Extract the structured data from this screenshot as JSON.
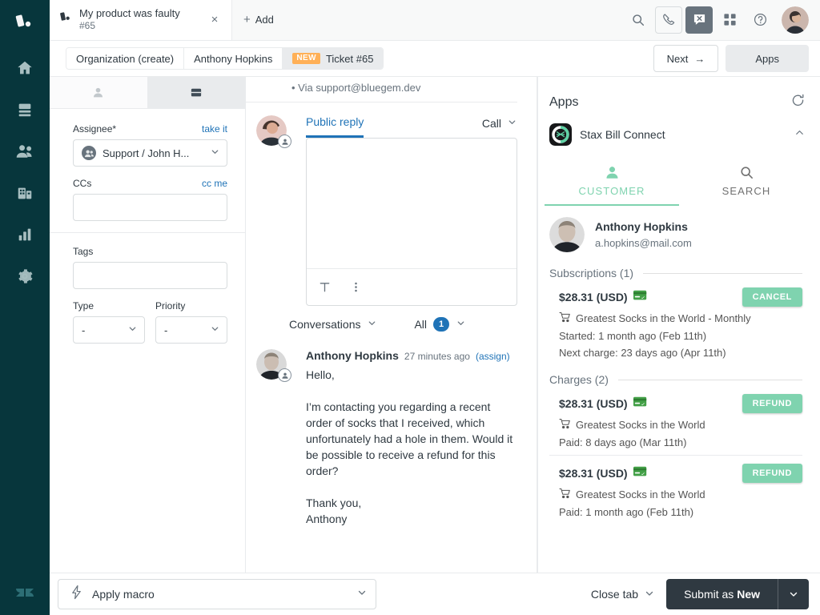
{
  "nav": {
    "logo_icon": "zendesk-product-tray-icon",
    "items": [
      {
        "label": "Home",
        "icon": "home-icon"
      },
      {
        "label": "Views",
        "icon": "views-icon"
      },
      {
        "label": "Customers",
        "icon": "customers-icon"
      },
      {
        "label": "Organizations",
        "icon": "organizations-icon"
      },
      {
        "label": "Reporting",
        "icon": "reporting-icon"
      },
      {
        "label": "Admin",
        "icon": "gear-icon"
      }
    ],
    "bottom_logo_icon": "zendesk-logo-icon"
  },
  "topbar": {
    "ticket_tab": {
      "title": "My product was faulty",
      "subtitle": "#65",
      "icon": "ticket-icon",
      "close": "×"
    },
    "add_tab_label": "Add",
    "add_tab_plus": "+",
    "actions": [
      {
        "name": "search-icon"
      },
      {
        "name": "call-icon"
      },
      {
        "name": "chat-disabled-icon"
      },
      {
        "name": "apps-grid-icon"
      },
      {
        "name": "help-icon"
      }
    ],
    "avatar_name": "user-avatar"
  },
  "breadcrumb": {
    "items": [
      {
        "label": "Organization (create)",
        "active": false,
        "badge": ""
      },
      {
        "label": "Anthony Hopkins",
        "active": false,
        "badge": ""
      },
      {
        "label": "Ticket #65",
        "active": true,
        "badge": "NEW"
      }
    ],
    "next_label": "Next",
    "next_arrow": "→",
    "apps_label": "Apps"
  },
  "properties": {
    "tabs": [
      {
        "icon": "user-icon",
        "active": false
      },
      {
        "icon": "ticket-card-icon",
        "active": true
      }
    ],
    "assignee": {
      "label": "Assignee*",
      "link": "take it",
      "value": "Support / John H...",
      "avatar_icon": "group-avatar-icon"
    },
    "ccs": {
      "label": "CCs",
      "link": "cc me",
      "value": "",
      "placeholder": ""
    },
    "tags": {
      "label": "Tags",
      "value": "",
      "placeholder": ""
    },
    "type": {
      "label": "Type",
      "value": "-"
    },
    "priority": {
      "label": "Priority",
      "value": "-"
    }
  },
  "conversation": {
    "via_line": "• Via support@bluegem.dev",
    "composer": {
      "avatar_name": "agent-avatar",
      "tab_label": "Public reply",
      "channel_label": "Call",
      "editor_value": "",
      "editor_placeholder": "",
      "tools": [
        {
          "name": "text-format-icon",
          "glyph": "T"
        },
        {
          "name": "more-options-icon",
          "glyph": "⋮"
        }
      ]
    },
    "filter": {
      "left_label": "Conversations",
      "right_label": "All",
      "count": "1"
    },
    "comments": [
      {
        "author": "Anthony Hopkins",
        "time": "27 minutes ago",
        "assign_link": "(assign)",
        "avatar_name": "customer-avatar",
        "body": "Hello,\n\nI’m contacting you regarding a recent order of socks that I received, which unfortunately had a hole in them. Would it be possible to receive a refund for this order?\n\nThank you,\nAnthony"
      }
    ]
  },
  "apps_panel": {
    "title": "Apps",
    "refresh_icon": "refresh-icon",
    "app": {
      "name": "Stax Bill Connect",
      "icon": "stax-bill-icon",
      "collapse_icon": "chevron-up-icon"
    },
    "tabs": [
      {
        "label": "CUSTOMER",
        "icon": "person-icon",
        "active": true
      },
      {
        "label": "SEARCH",
        "icon": "search-icon",
        "active": false
      }
    ],
    "customer": {
      "name": "Anthony Hopkins",
      "email": "a.hopkins@mail.com",
      "avatar_name": "customer-avatar"
    },
    "subscriptions": {
      "heading": "Subscriptions (1)",
      "items": [
        {
          "amount": "$28.31 (USD)",
          "card_icon": "credit-card-paid-icon",
          "action": "CANCEL",
          "product": "Greatest Socks in the World - Monthly",
          "line2": "Started: 1 month ago (Feb 11th)",
          "line3": "Next charge: 23 days ago (Apr 11th)"
        }
      ]
    },
    "charges": {
      "heading": "Charges (2)",
      "items": [
        {
          "amount": "$28.31 (USD)",
          "card_icon": "credit-card-paid-icon",
          "action": "REFUND",
          "product": "Greatest Socks in the World",
          "line2": "Paid: 8 days ago (Mar 11th)",
          "line3": ""
        },
        {
          "amount": "$28.31 (USD)",
          "card_icon": "credit-card-paid-icon",
          "action": "REFUND",
          "product": "Greatest Socks in the World",
          "line2": "Paid: 1 month ago (Feb 11th)",
          "line3": ""
        }
      ]
    }
  },
  "footer": {
    "macro_label": "Apply macro",
    "macro_icon": "lightning-icon",
    "close_tab_label": "Close tab",
    "submit_label_prefix": "Submit as ",
    "submit_label_strong": "New",
    "submit_caret_icon": "chevron-down-icon"
  },
  "colors": {
    "nav_bg": "#07363c",
    "accent_blue": "#1f73b7",
    "accent_green": "#7fd3af",
    "badge_orange": "#ffb057",
    "dark_button": "#2f3941",
    "card_green": "#43a047"
  }
}
